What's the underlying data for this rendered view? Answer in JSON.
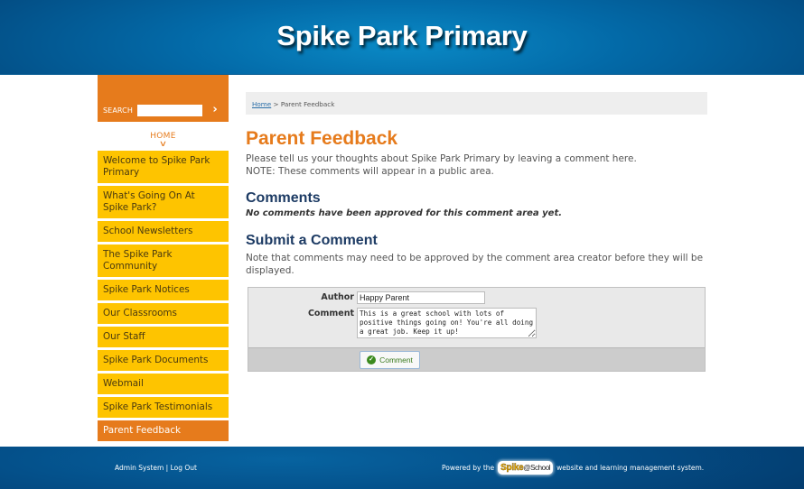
{
  "header": {
    "title": "Spike Park Primary"
  },
  "sidebar": {
    "search_label": "SEARCH",
    "search_value": "",
    "search_go_icon": "chevron-right",
    "home_label": "HOME",
    "home_chevron_icon": "chevron-down",
    "nav_items": [
      {
        "label": "Welcome to Spike Park Primary",
        "active": false
      },
      {
        "label": "What's Going On At Spike Park?",
        "active": false
      },
      {
        "label": "School Newsletters",
        "active": false
      },
      {
        "label": "The Spike Park Community",
        "active": false
      },
      {
        "label": "Spike Park Notices",
        "active": false
      },
      {
        "label": "Our Classrooms",
        "active": false
      },
      {
        "label": "Our Staff",
        "active": false
      },
      {
        "label": "Spike Park Documents",
        "active": false
      },
      {
        "label": "Webmail",
        "active": false
      },
      {
        "label": "Spike Park Testimonials",
        "active": false
      },
      {
        "label": "Parent Feedback",
        "active": true
      }
    ]
  },
  "breadcrumb": {
    "home": "Home",
    "separator": ">",
    "current": "Parent Feedback"
  },
  "main": {
    "title": "Parent Feedback",
    "intro_line1": "Please tell us your thoughts about Spike Park Primary by leaving a comment here.",
    "intro_line2": "NOTE: These comments will appear in a public area.",
    "comments_heading": "Comments",
    "no_comments": "No comments have been approved for this comment area yet.",
    "submit_heading": "Submit a Comment",
    "submit_note": "Note that comments may need to be approved by the comment area creator before they will be displayed."
  },
  "form": {
    "author_label": "Author",
    "author_value": "Happy Parent",
    "comment_label": "Comment",
    "comment_value": "This is a great school with lots of positive things going on! You're all doing a great job. Keep it up!",
    "submit_label": "Comment",
    "submit_icon": "check-circle"
  },
  "footer": {
    "admin_link": "Admin System",
    "separator": "|",
    "logout_link": "Log Out",
    "powered_prefix": "Powered by the",
    "logo_spike": "Spike",
    "logo_school": "@School",
    "powered_suffix": "website and learning management system."
  },
  "colors": {
    "header_blue": "#036aa8",
    "accent_orange": "#e67b1c",
    "nav_yellow": "#fec400",
    "heading_navy": "#1d3b64"
  }
}
